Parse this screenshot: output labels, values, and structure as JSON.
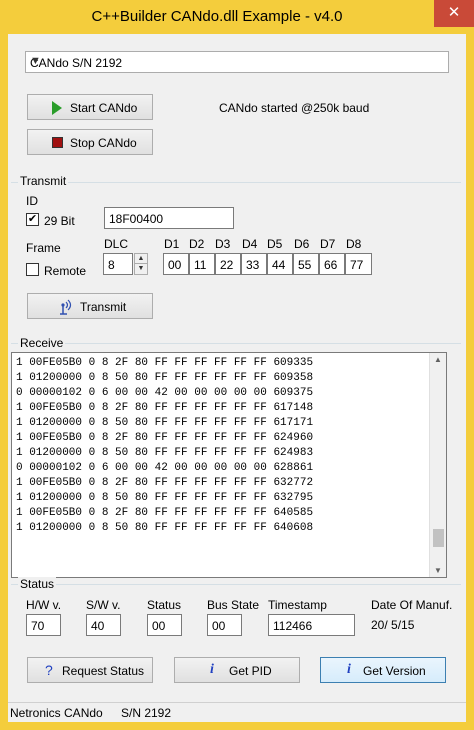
{
  "window": {
    "title": "C++Builder CANdo.dll Example - v4.0",
    "close_glyph": "✕"
  },
  "device_select": {
    "selected": "CANdo S/N 2192"
  },
  "controls": {
    "start_label": "Start CANdo",
    "stop_label": "Stop CANdo",
    "status_message": "CANdo started @250k baud"
  },
  "transmit": {
    "group_title": "Transmit",
    "id_label": "ID",
    "bit29_label": "29 Bit",
    "bit29_checked": true,
    "id_value": "18F00400",
    "frame_label": "Frame",
    "remote_label": "Remote",
    "remote_checked": false,
    "dlc_label": "DLC",
    "dlc_value": "8",
    "data_headers": [
      "D1",
      "D2",
      "D3",
      "D4",
      "D5",
      "D6",
      "D7",
      "D8"
    ],
    "data_values": [
      "00",
      "11",
      "22",
      "33",
      "44",
      "55",
      "66",
      "77"
    ],
    "transmit_label": "Transmit"
  },
  "receive": {
    "group_title": "Receive",
    "lines": [
      "1 00FE05B0 0 8 2F 80 FF FF FF FF FF FF 609335",
      "1 01200000 0 8 50 80 FF FF FF FF FF FF 609358",
      "0 00000102 0 6 00 00 42 00 00 00 00 00 609375",
      "1 00FE05B0 0 8 2F 80 FF FF FF FF FF FF 617148",
      "1 01200000 0 8 50 80 FF FF FF FF FF FF 617171",
      "1 00FE05B0 0 8 2F 80 FF FF FF FF FF FF 624960",
      "1 01200000 0 8 50 80 FF FF FF FF FF FF 624983",
      "0 00000102 0 6 00 00 42 00 00 00 00 00 628861",
      "1 00FE05B0 0 8 2F 80 FF FF FF FF FF FF 632772",
      "1 01200000 0 8 50 80 FF FF FF FF FF FF 632795",
      "1 00FE05B0 0 8 2F 80 FF FF FF FF FF FF 640585",
      "1 01200000 0 8 50 80 FF FF FF FF FF FF 640608"
    ]
  },
  "status": {
    "group_title": "Status",
    "hw_label": "H/W v.",
    "hw_value": "70",
    "sw_label": "S/W v.",
    "sw_value": "40",
    "status_label": "Status",
    "status_value": "00",
    "bus_label": "Bus State",
    "bus_value": "00",
    "timestamp_label": "Timestamp",
    "timestamp_value": "112466",
    "manuf_label": "Date Of Manuf.",
    "manuf_value": "20/ 5/15",
    "request_status_label": "Request Status",
    "get_pid_label": "Get PID",
    "get_version_label": "Get Version"
  },
  "statusbar": {
    "maker": "Netronics CANdo",
    "serial": "S/N 2192"
  },
  "colors": {
    "frame": "#f4cd3c",
    "close": "#c94a38",
    "play": "#2a9d2a",
    "stop": "#a01010",
    "info_icon": "#2040c0"
  },
  "icons": [
    "play-icon",
    "stop-icon",
    "antenna-icon",
    "question-icon",
    "info-icon",
    "chevron-down-icon"
  ]
}
